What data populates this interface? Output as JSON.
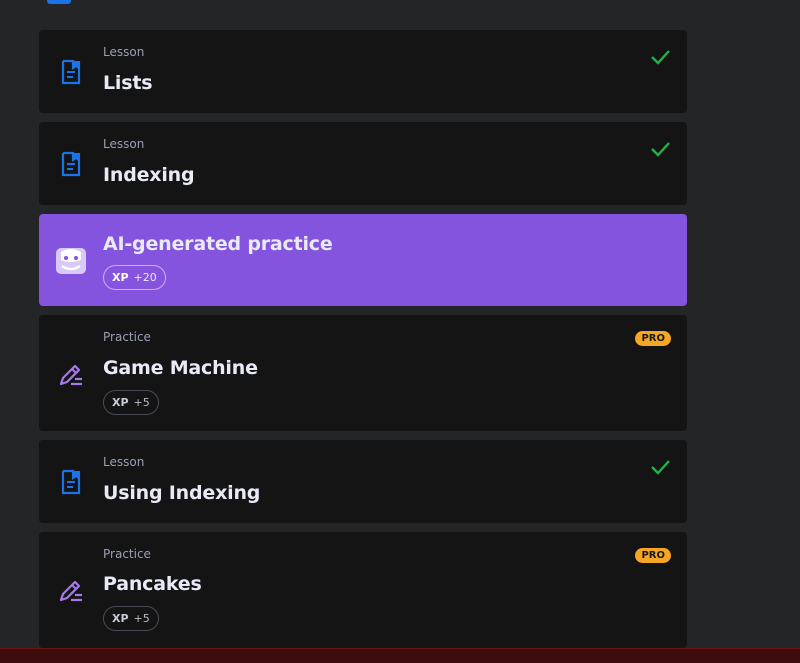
{
  "colors": {
    "background": "#242526",
    "card": "#141414",
    "ai_card": "#8454df",
    "lesson_icon": "#1a73e8",
    "practice_icon": "#a678f0",
    "check": "#22b24c",
    "pro_badge": "#f5a623"
  },
  "cards": [
    {
      "type": "Lesson",
      "title": "Lists",
      "icon": "document-icon",
      "status": "completed-check-icon"
    },
    {
      "type": "Lesson",
      "title": "Indexing",
      "icon": "document-icon",
      "status": "completed-check-icon"
    },
    {
      "title": "AI-generated practice",
      "icon": "ai-robot-icon",
      "xp_label": "XP",
      "xp_value": "+20"
    },
    {
      "type": "Practice",
      "title": "Game Machine",
      "icon": "pencil-icon",
      "badge": "PRO",
      "xp_label": "XP",
      "xp_value": "+5"
    },
    {
      "type": "Lesson",
      "title": "Using Indexing",
      "icon": "document-icon",
      "status": "completed-check-icon"
    },
    {
      "type": "Practice",
      "title": "Pancakes",
      "icon": "pencil-icon",
      "badge": "PRO",
      "xp_label": "XP",
      "xp_value": "+5"
    }
  ]
}
